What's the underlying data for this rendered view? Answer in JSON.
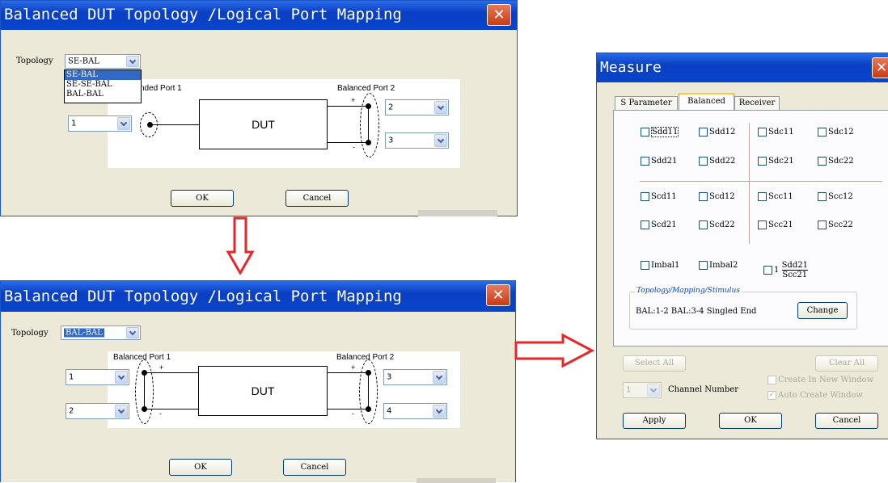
{
  "dialog1": {
    "title": "Balanced DUT Topology /Logical Port Mapping",
    "topology_label": "Topology",
    "topology_value": "SE-BAL",
    "topology_options": [
      "SE-BAL",
      "SE-SE-BAL",
      "BAL-BAL"
    ],
    "port_left_label": "nded Port 1",
    "port_right_label": "Balanced Port 2",
    "dut_label": "DUT",
    "combo_left": "1",
    "combo_right_top": "2",
    "combo_right_bottom": "3",
    "plus": "+",
    "minus": "-",
    "ok": "OK",
    "cancel": "Cancel"
  },
  "dialog2": {
    "title": "Balanced DUT Topology /Logical Port Mapping",
    "topology_label": "Topology",
    "topology_value": "BAL-BAL",
    "port_left_label": "Balanced Port 1",
    "port_right_label": "Balanced Port 2",
    "dut_label": "DUT",
    "combo_left_top": "1",
    "combo_left_bottom": "2",
    "combo_right_top": "3",
    "combo_right_bottom": "4",
    "plus": "+",
    "minus": "-",
    "ok": "OK",
    "cancel": "Cancel"
  },
  "measure": {
    "title": "Measure",
    "tabs": [
      "S Parameter",
      "Balanced",
      "Receiver"
    ],
    "active_tab": "Balanced",
    "grid": [
      [
        "Sdd11",
        "Sdd12",
        "Sdc11",
        "Sdc12"
      ],
      [
        "Sdd21",
        "Sdd22",
        "Sdc21",
        "Sdc22"
      ],
      [
        "Scd11",
        "Scd12",
        "Scc11",
        "Scc12"
      ],
      [
        "Scd21",
        "Scd22",
        "Scc21",
        "Scc22"
      ]
    ],
    "imbal1": "Imbal1",
    "imbal2": "Imbal2",
    "cmrr_prefix": "1",
    "cmrr_numerator": "Sdd21",
    "cmrr_denominator": "Scc21",
    "group_title": "Topology/Mapping/Stimulus",
    "topology_text": "BAL:1-2 BAL:3-4 Singled End",
    "change": "Change",
    "select_all": "Select All",
    "clear_all": "Clear All",
    "channel_value": "1",
    "channel_label": "Channel Number",
    "create_new_window": "Create In New Window",
    "auto_create_window": "Auto Create Window",
    "apply": "Apply",
    "ok": "OK",
    "cancel": "Cancel"
  },
  "colors": {
    "title_blue": "#0a3fc4",
    "arrow_red": "#e8262a",
    "close_red": "#d2451c"
  },
  "icons": {
    "close": "close-icon",
    "arrow_down": "arrow-down-icon",
    "arrow_right": "arrow-right-icon"
  }
}
